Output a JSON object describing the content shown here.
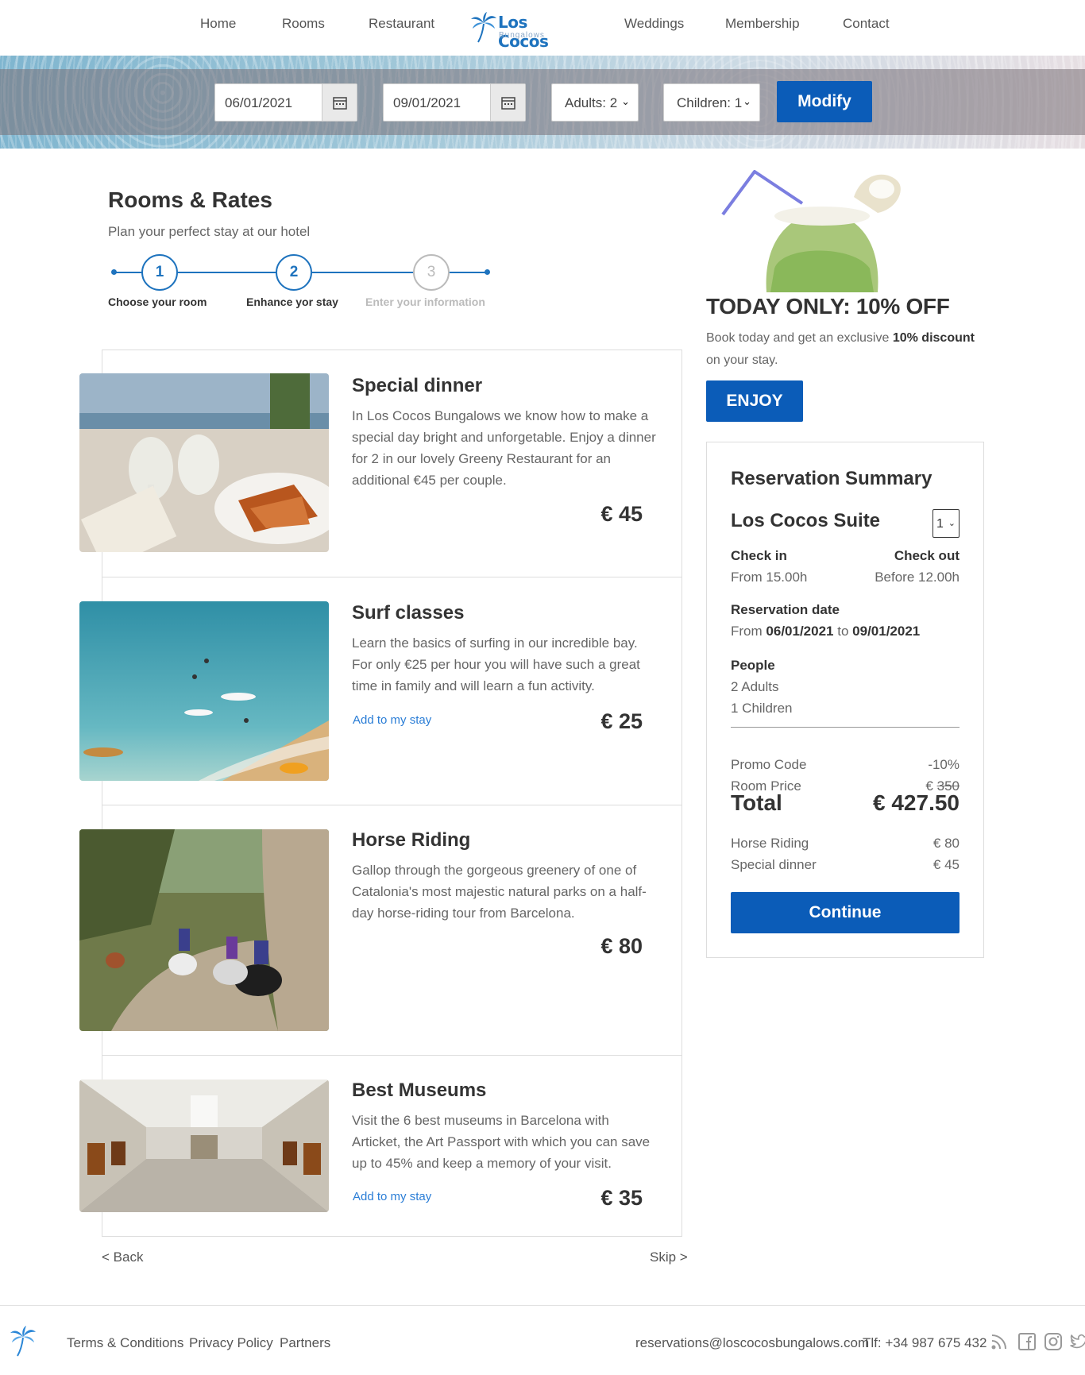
{
  "nav": {
    "items": [
      "Home",
      "Rooms",
      "Restaurant",
      "Weddings",
      "Membership",
      "Contact"
    ],
    "logo_title": "Los Cocos",
    "logo_subtitle": "Bungalows"
  },
  "search": {
    "checkin": "06/01/2021",
    "checkout": "09/01/2021",
    "adults": "Adults: 2",
    "children": "Children: 1",
    "modify": "Modify"
  },
  "page": {
    "title": "Rooms & Rates",
    "subtitle": "Plan your perfect stay at our hotel"
  },
  "steps": [
    {
      "number": "1",
      "label": "Choose your room"
    },
    {
      "number": "2",
      "label": "Enhance yor stay"
    },
    {
      "number": "3",
      "label": "Enter your information"
    }
  ],
  "extras": [
    {
      "title": "Special dinner",
      "description": "In Los Cocos Bungalows we know how to make a special day bright and unforgetable. Enjoy a dinner for 2 in our lovely Greeny Restaurant for an additional €45 per couple.",
      "price": "€ 45",
      "link": ""
    },
    {
      "title": "Surf classes",
      "description": "Learn the basics of surfing in our incredible bay. For only €25 per hour you will have such a great time in family and will learn a fun activity.",
      "price": "€ 25",
      "link": "Add to my stay"
    },
    {
      "title": "Horse Riding",
      "description": "Gallop through the gorgeous greenery of one of Catalonia's most majestic natural parks on a half-day horse-riding tour from Barcelona.",
      "price": "€ 80",
      "link": ""
    },
    {
      "title": "Best Museums",
      "description": "Visit the 6 best museums in Barcelona with Articket, the Art Passport with which you can save up to 45% and keep a memory of your visit.",
      "price": "€ 35",
      "link": "Add to my stay"
    }
  ],
  "nav_bottom": {
    "back": "< Back",
    "skip": "Skip >"
  },
  "promo": {
    "title": "TODAY ONLY: 10% OFF",
    "text_before": "Book today and get an exclusive ",
    "text_bold": "10% discount",
    "text_after": " on your stay.",
    "button": "ENJOY"
  },
  "summary": {
    "title": "Reservation Summary",
    "room": "Los Cocos Suite",
    "quantity": "1",
    "checkin_label": "Check in",
    "checkin_value": "From 15.00h",
    "checkout_label": "Check out",
    "checkout_value": "Before 12.00h",
    "date_label": "Reservation date",
    "date_from_word": "From",
    "date_from": "06/01/2021",
    "date_to_word": "to",
    "date_to": "09/01/2021",
    "people_label": "People",
    "adults": "2 Adults",
    "children": "1 Children",
    "promo_label": "Promo Code",
    "promo_value": "-10%",
    "room_price_label": "Room Price",
    "room_price_currency": "€",
    "room_price_value": "350",
    "total_label": "Total",
    "total_value": "€ 427.50",
    "extras": [
      {
        "label": "Horse Riding",
        "value": "€ 80"
      },
      {
        "label": "Special dinner",
        "value": "€ 45"
      }
    ],
    "continue": "Continue"
  },
  "footer": {
    "links": [
      "Terms & Conditions",
      "Privacy Policy",
      "Partners"
    ],
    "email": "reservations@loscocosbungalows.com",
    "phone": "Tlf: +34 987 675 432"
  },
  "colors": {
    "primary": "#0b5cb8",
    "link": "#2a7dd6",
    "logo": "#1e73be"
  }
}
